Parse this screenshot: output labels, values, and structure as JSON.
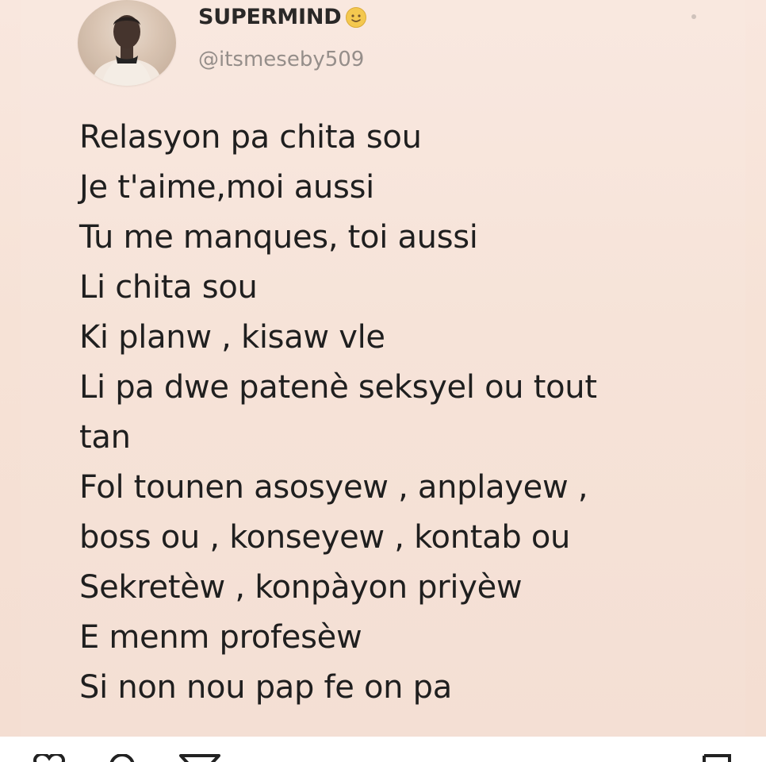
{
  "user": {
    "display_name": "SUPERMIND",
    "name_emoji": "slightly-smiling-face-emoji",
    "handle": "@itsmeseby509",
    "avatar": "profile-photo"
  },
  "tweet": {
    "lines": [
      "Relasyon pa chita sou",
      "Je t'aime,moi aussi",
      "Tu me manques, toi aussi",
      "Li chita sou",
      "Ki planw , kisaw vle",
      "Li pa dwe patenè seksyel ou tout",
      "tan",
      "Fol tounen asosyew , anplayew ,",
      "boss ou , konseyew , kontab ou",
      "Sekretèw , konpàyon priyèw",
      "E menm profesèw",
      "Si non nou pap fe on pa"
    ]
  },
  "actions": {
    "icons": [
      "heart-icon",
      "comment-icon",
      "share-icon",
      "bookmark-icon"
    ]
  },
  "colors": {
    "card_background": "#f7e6dc",
    "text": "#111111",
    "handle": "#8f8783",
    "action_bar": "#ffffff"
  }
}
